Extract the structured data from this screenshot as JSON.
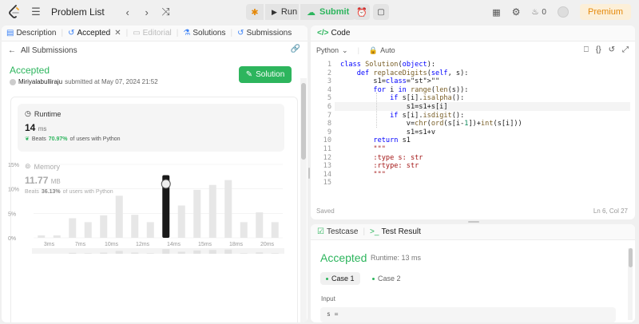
{
  "topbar": {
    "problem_list_label": "Problem List",
    "run_label": "Run",
    "submit_label": "Submit",
    "streak_count": "0",
    "premium_label": "Premium"
  },
  "left_panel": {
    "tabs": [
      {
        "label": "Description"
      },
      {
        "label": "Accepted"
      },
      {
        "label": "Editorial"
      },
      {
        "label": "Solutions"
      },
      {
        "label": "Submissions"
      }
    ],
    "back_label": "All Submissions",
    "status": "Accepted",
    "user": "Miriyalabulliraju",
    "submitted_text": "submitted at May 07, 2024 21:52",
    "solution_button": "Solution",
    "runtime": {
      "label": "Runtime",
      "value": "14",
      "unit": "ms",
      "beats_prefix": "Beats",
      "beats_pct": "70.97%",
      "beats_suffix": "of users with Python"
    },
    "memory": {
      "label": "Memory",
      "value": "11.77",
      "unit": "MB",
      "beats_prefix": "Beats",
      "beats_pct": "36.13%",
      "beats_suffix": "of users with Python"
    }
  },
  "chart_data": {
    "type": "bar",
    "title": "",
    "xlabel": "",
    "ylabel": "",
    "y_ticks": [
      "0%",
      "5%",
      "10%",
      "15%"
    ],
    "ylim": [
      0,
      15
    ],
    "x_tick_labels": [
      "3ms",
      "7ms",
      "10ms",
      "12ms",
      "14ms",
      "15ms",
      "18ms",
      "20ms"
    ],
    "values": [
      0.5,
      0.5,
      4,
      3.2,
      4.6,
      8.6,
      4.7,
      3.2,
      12.8,
      6.6,
      9.8,
      10.8,
      11.8,
      3.2,
      5.2,
      3.2
    ],
    "highlight_index": 8,
    "colors": {
      "bar": "#e7e7e7",
      "highlight": "#1a1a1a"
    }
  },
  "code_panel": {
    "title": "Code",
    "language": "Python",
    "mode": "Auto",
    "lines": [
      "class Solution(object):",
      "    def replaceDigits(self, s):",
      "        s1=\"\"",
      "        for i in range(len(s)):",
      "            if s[i].isalpha():",
      "                s1=s1+s[i]",
      "            if s[i].isdigit():",
      "                v=chr(ord(s[i-1])+int(s[i]))",
      "                s1=s1+v",
      "        return s1",
      "        \"\"\"",
      "        :type s: str",
      "        :rtype: str",
      "        \"\"\"",
      ""
    ],
    "saved_label": "Saved",
    "cursor_label": "Ln 6, Col 27"
  },
  "test_panel": {
    "tab_testcase": "Testcase",
    "tab_result": "Test Result",
    "status": "Accepted",
    "runtime": "Runtime: 13 ms",
    "case1": "Case 1",
    "case2": "Case 2",
    "input_label": "Input",
    "input_value": "s ="
  }
}
